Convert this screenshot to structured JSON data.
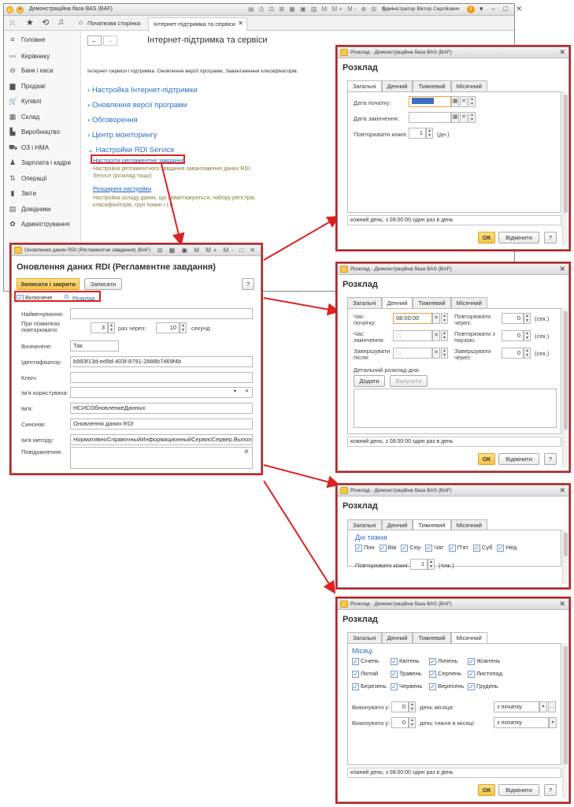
{
  "main": {
    "title": "Демонстраційна база BAS  (BAF)",
    "user": "Адміністратор Віктор Сергійович",
    "tab_home": "Початкова сторінка",
    "tab_active": "Інтернет-підтримка та сервіси",
    "page_title": "Інтернет-підтримка та сервіси",
    "description": "Інтернет-сервіси і підтримка. Оновлення версії програми. Завантаження класифікаторів.",
    "groups": [
      "Настройка Інтернет-підтримки",
      "Оновлення версії програми",
      "Обговорення",
      "Центр моніторингу"
    ],
    "rdi_group": "Настройки RDI Service",
    "rdi_link1": "Настроїти регламентне завдання",
    "rdi_desc1": "Настройка регламентного завдання завантаження даних RDI Service (розклад тощо)",
    "rdi_link2": "Розширені настройки",
    "rdi_desc2": "Настройка складу даних, що завантажуються, набору регістрів, класифікаторів, груп новин і т.п."
  },
  "sidebar": {
    "items": [
      {
        "icon": "menu-icon",
        "glyph": "≡",
        "label": "Головне"
      },
      {
        "icon": "chart-icon",
        "glyph": "〰",
        "label": "Керівнику"
      },
      {
        "icon": "bank-icon",
        "glyph": "⊖",
        "label": "Банк і каса"
      },
      {
        "icon": "sales-icon",
        "glyph": "▆",
        "label": "Продажі"
      },
      {
        "icon": "cart-icon",
        "glyph": "🛒",
        "label": "Купівлі"
      },
      {
        "icon": "warehouse-icon",
        "glyph": "▦",
        "label": "Склад"
      },
      {
        "icon": "factory-icon",
        "glyph": "▙",
        "label": "Виробництво"
      },
      {
        "icon": "truck-icon",
        "glyph": "⛟",
        "label": "ОЗ і НМА"
      },
      {
        "icon": "person-icon",
        "glyph": "♟",
        "label": "Зарплата і кадри"
      },
      {
        "icon": "operations-icon",
        "glyph": "⇅",
        "label": "Операції"
      },
      {
        "icon": "reports-icon",
        "glyph": "▮",
        "label": "Звіти"
      },
      {
        "icon": "book-icon",
        "glyph": "▤",
        "label": "Довідники"
      },
      {
        "icon": "gear-icon",
        "glyph": "✿",
        "label": "Адміністрування"
      }
    ]
  },
  "rdi": {
    "win_title": "Оновлення даних RDI (Регламентне завдання)  (BAF)",
    "heading": "Оновлення даних RDI (Регламентне завдання)",
    "save_close": "Записати і закрити",
    "save": "Записати",
    "help": "?",
    "enabled_label": "Включене",
    "schedule_link": "Розклад",
    "f_name": "Найменування:",
    "f_errors": "При помилках повторювати:",
    "f_errors_val": "3",
    "f_times": "раз через:",
    "f_interval": "10",
    "f_seconds": "секунд",
    "f_predef": "Визначене:",
    "f_predef_val": "Так",
    "f_id": "Ідентифікатор:",
    "f_id_val": "b993f13d-ed9d-403f-8791-2888b7469f4b",
    "f_key": "Ключ:",
    "f_user": "Ім'я користувача:",
    "f_nm": "Ім'я:",
    "f_nm_val": "НСИСОбновлениеДанных",
    "f_syn": "Синонім:",
    "f_syn_val": "Оновлення даних RDI",
    "f_method": "Ім'я методу:",
    "f_method_val": "НормативноСправочныйИнформационныйСервисСервер.Выполнит",
    "f_msg": "Повідомлення:"
  },
  "sched": {
    "win_title": "Розклад - Демонстраційна база BAS  (BAF)",
    "heading": "Розклад",
    "tabs": [
      "Загальні",
      "Денний",
      "Тижневий",
      "Місячний"
    ],
    "ok": "ОК",
    "cancel": "Відмінити",
    "help": "?",
    "status": "кожний день; з 08:00:00 один раз в день",
    "start_date": "Дата початку:",
    "end_date": "Дата закінчення:",
    "end_date_ph": "  .  .",
    "repeat_every": "Повторювати кожні:",
    "repeat_days_val": "1",
    "days_unit": "(дн.)",
    "start_time": "Час початку:",
    "start_time_val": "08:00:00",
    "end_time": "Час закінчення:",
    "end_after": "Завершувати після:",
    "time_ph": " : :",
    "repeat_after": "Повторювати через:",
    "repeat_pause": "Повторювати з паузою:",
    "finish_after": "Завершувати через:",
    "zero": "0",
    "sec_unit": "(сек.)",
    "detail_label": "Детальний розклад дня:",
    "add": "Додати",
    "remove": "Вилучити",
    "week_days_title": "Дні тижня",
    "week_days": [
      "Пон",
      "Вів",
      "Сер",
      "Чат",
      "П'ят",
      "Суб",
      "Нед"
    ],
    "repeat_weeks_val": "1",
    "weeks_unit": "(тиж.)",
    "months_title": "Місяці",
    "months": [
      [
        "Січень",
        "Квітень",
        "Липень",
        "Жовтень"
      ],
      [
        "Лютий",
        "Травень",
        "Серпень",
        "Листопад"
      ],
      [
        "Березень",
        "Червень",
        "Вересень",
        "Грудень"
      ]
    ],
    "exec_on": "Виконувати у:",
    "day_of_month": "день місяця:",
    "day_of_week_month": "день тижня в місяці:",
    "from_start": "з початку"
  }
}
